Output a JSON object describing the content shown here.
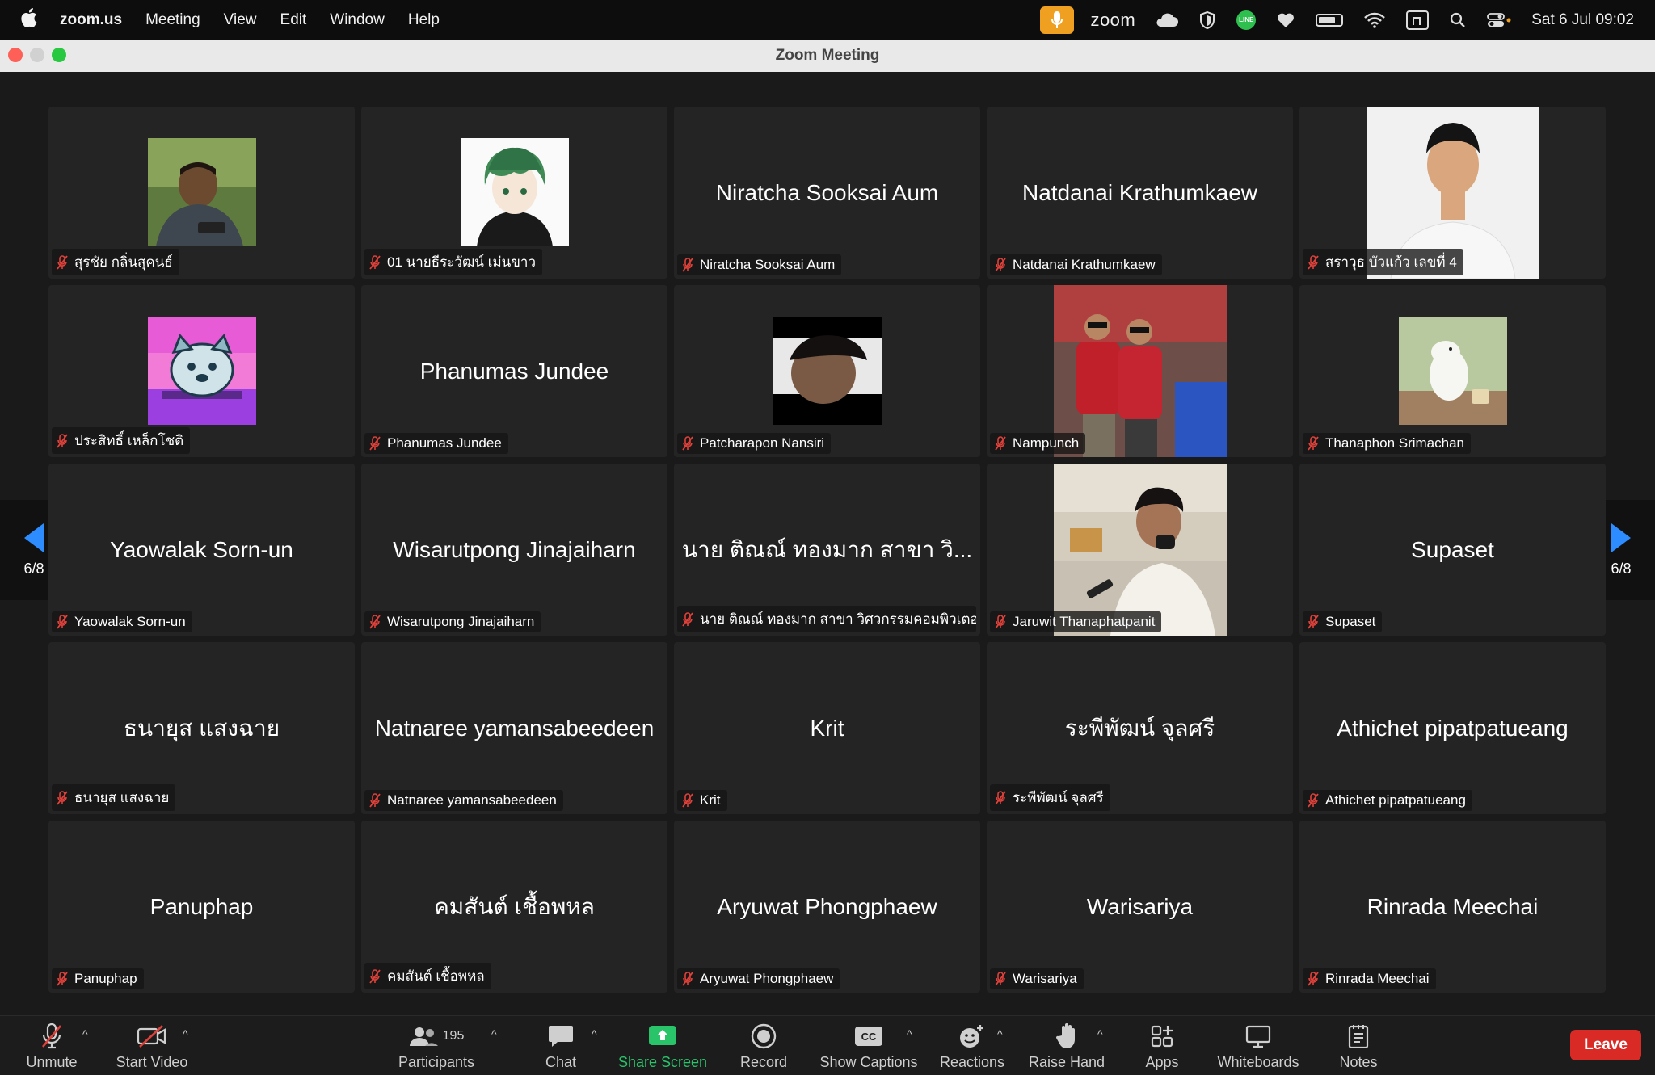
{
  "menubar": {
    "app": "zoom.us",
    "items": [
      "Meeting",
      "View",
      "Edit",
      "Window",
      "Help"
    ],
    "zoom_word": "zoom",
    "clock": "Sat 6 Jul  09:02"
  },
  "window": {
    "title": "Zoom Meeting"
  },
  "pagination": {
    "left": "6/8",
    "right": "6/8"
  },
  "tiles": [
    {
      "display": "",
      "label": "สุรชัย กลิ่นสุคนธ์",
      "media": "photo"
    },
    {
      "display": "",
      "label": "01 นายธีระวัฒน์ เม่นขาว",
      "media": "avatar-anime"
    },
    {
      "display": "Niratcha Sooksai Aum",
      "label": "Niratcha Sooksai Aum",
      "media": "none"
    },
    {
      "display": "Natdanai Krathumkaew",
      "label": "Natdanai Krathumkaew",
      "media": "none"
    },
    {
      "display": "",
      "label": "สราวุธ บัวแก้ว เลขที่ 4",
      "media": "video-white"
    },
    {
      "display": "",
      "label": "ประสิทธิ์ เหล็กโชติ",
      "media": "avatar-dog"
    },
    {
      "display": "Phanumas Jundee",
      "label": "Phanumas Jundee",
      "media": "none"
    },
    {
      "display": "",
      "label": "Patcharapon Nansiri",
      "media": "avatar-dark"
    },
    {
      "display": "",
      "label": "Nampunch",
      "media": "video-red"
    },
    {
      "display": "",
      "label": "Thanaphon Srimachan",
      "media": "avatar-moomin"
    },
    {
      "display": "Yaowalak Sorn-un",
      "label": "Yaowalak Sorn-un",
      "media": "none"
    },
    {
      "display": "Wisarutpong Jinajaiharn",
      "label": "Wisarutpong Jinajaiharn",
      "media": "none"
    },
    {
      "display": "นาย ติณณ์ ทองมาก สาขา วิ...",
      "label": "นาย ติณณ์ ทองมาก สาขา วิศวกรรมคอมพิวเตอร์",
      "media": "none"
    },
    {
      "display": "",
      "label": "Jaruwit Thanaphatpanit",
      "media": "video-street"
    },
    {
      "display": "Supaset",
      "label": "Supaset",
      "media": "none"
    },
    {
      "display": "ธนายุส แสงฉาย",
      "label": "ธนายุส แสงฉาย",
      "media": "none"
    },
    {
      "display": "Natnaree yamansabeedeen",
      "label": "Natnaree yamansabeedeen",
      "media": "none"
    },
    {
      "display": "Krit",
      "label": "Krit",
      "media": "none"
    },
    {
      "display": "ระพีพัฒน์ จุลศรี",
      "label": "ระพีพัฒน์ จุลศรี",
      "media": "none"
    },
    {
      "display": "Athichet pipatpatueang",
      "label": "Athichet pipatpatueang",
      "media": "none"
    },
    {
      "display": "Panuphap",
      "label": "Panuphap",
      "media": "none"
    },
    {
      "display": "คมสันต์ เชื้อพหล",
      "label": "คมสันต์ เชื้อพหล",
      "media": "none"
    },
    {
      "display": "Aryuwat Phongphaew",
      "label": "Aryuwat Phongphaew",
      "media": "none"
    },
    {
      "display": "Warisariya",
      "label": "Warisariya",
      "media": "none"
    },
    {
      "display": "Rinrada Meechai",
      "label": "Rinrada Meechai",
      "media": "none"
    }
  ],
  "toolbar": {
    "unmute": "Unmute",
    "start_video": "Start Video",
    "participants": "Participants",
    "participants_count": "195",
    "chat": "Chat",
    "share_screen": "Share Screen",
    "record": "Record",
    "show_captions": "Show Captions",
    "reactions": "Reactions",
    "raise_hand": "Raise Hand",
    "apps": "Apps",
    "whiteboards": "Whiteboards",
    "notes": "Notes",
    "leave": "Leave",
    "cc_glyph": "CC"
  },
  "colors": {
    "accent": "#2d8cff",
    "share_green": "#29c46a",
    "leave_red": "#d92a26",
    "muted_red": "#e0413a"
  }
}
